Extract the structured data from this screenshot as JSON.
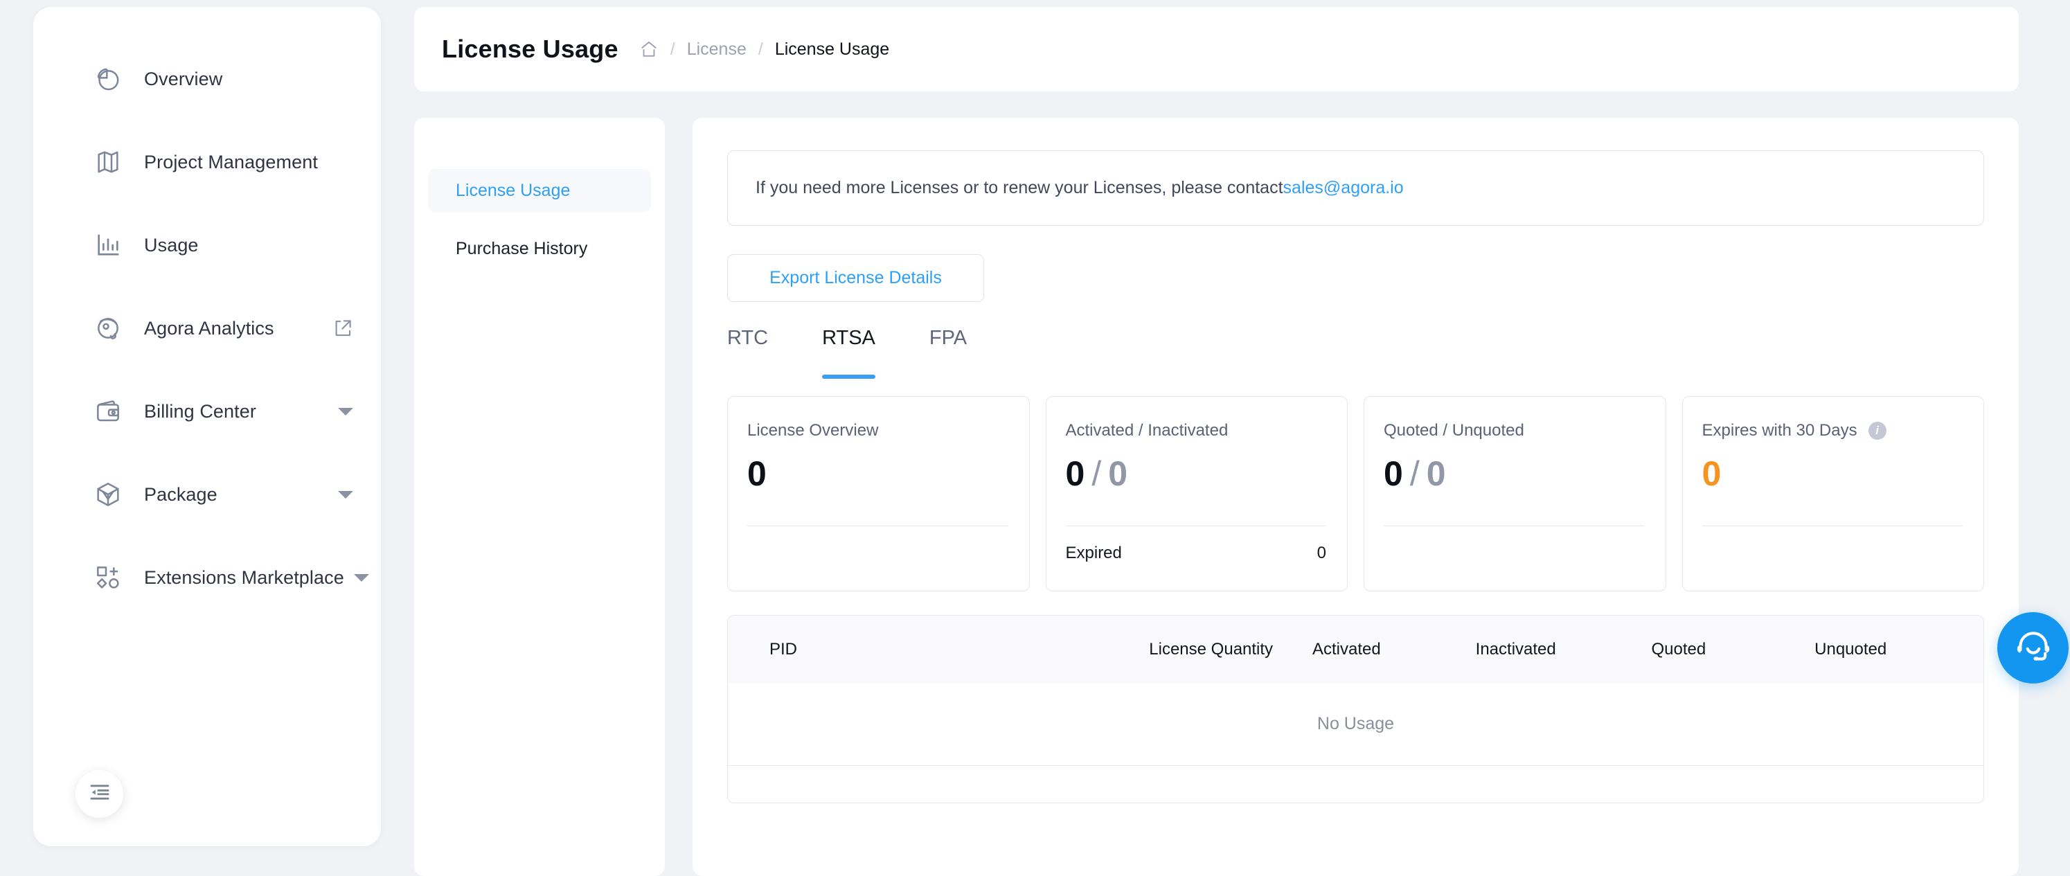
{
  "sidebar": {
    "items": [
      {
        "label": "Overview",
        "icon": "pie-chart-icon",
        "external": false,
        "caret": false
      },
      {
        "label": "Project Management",
        "icon": "map-icon",
        "external": false,
        "caret": false
      },
      {
        "label": "Usage",
        "icon": "bar-chart-icon",
        "external": false,
        "caret": false
      },
      {
        "label": "Agora Analytics",
        "icon": "analytics-icon",
        "external": true,
        "caret": false
      },
      {
        "label": "Billing Center",
        "icon": "wallet-icon",
        "external": false,
        "caret": true
      },
      {
        "label": "Package",
        "icon": "package-icon",
        "external": false,
        "caret": true
      },
      {
        "label": "Extensions Marketplace",
        "icon": "extensions-icon",
        "external": false,
        "caret": true
      }
    ],
    "collapse_button": "collapse-sidebar"
  },
  "header": {
    "title": "License Usage",
    "breadcrumb": {
      "home_icon": "home-icon",
      "separator": "/",
      "parent": "License",
      "current": "License Usage"
    }
  },
  "subnav": {
    "items": [
      {
        "label": "License Usage",
        "active": true
      },
      {
        "label": "Purchase History",
        "active": false
      }
    ]
  },
  "main": {
    "notice": {
      "text_before": "If you need more Licenses or to renew your Licenses, please contact ",
      "link": "sales@agora.io"
    },
    "export_button": "Export License Details",
    "tabs": [
      {
        "label": "RTC",
        "active": false
      },
      {
        "label": "RTSA",
        "active": true
      },
      {
        "label": "FPA",
        "active": false
      }
    ],
    "cards": [
      {
        "title": "License Overview",
        "primary": "0",
        "secondary": null,
        "accent": "#0d1117",
        "info": false,
        "footer_label": null,
        "footer_value": null
      },
      {
        "title": "Activated / Inactivated",
        "primary": "0",
        "secondary": "0",
        "accent": "#0d1117",
        "info": false,
        "footer_label": "Expired",
        "footer_value": "0"
      },
      {
        "title": "Quoted / Unquoted",
        "primary": "0",
        "secondary": "0",
        "accent": "#0d1117",
        "info": false,
        "footer_label": null,
        "footer_value": null
      },
      {
        "title": "Expires with 30 Days",
        "primary": "0",
        "secondary": null,
        "accent": "#f79421",
        "info": true,
        "footer_label": null,
        "footer_value": null
      }
    ],
    "table": {
      "columns": [
        "PID",
        "License Quantity",
        "Activated",
        "Inactivated",
        "Quoted",
        "Unquoted"
      ],
      "rows": [],
      "empty_text": "No Usage"
    }
  },
  "support_fab": {
    "icon": "headset-support-icon"
  },
  "colors": {
    "page_background": "#f1f2f6",
    "card_background": "#ffffff",
    "accent_blue": "#2ea0f8",
    "tab_underline": "#3a9ef5",
    "warning_orange": "#f79421",
    "fab_blue": "#1296f0",
    "border": "#e6e7ef",
    "muted_text": "#9aa1b1"
  }
}
